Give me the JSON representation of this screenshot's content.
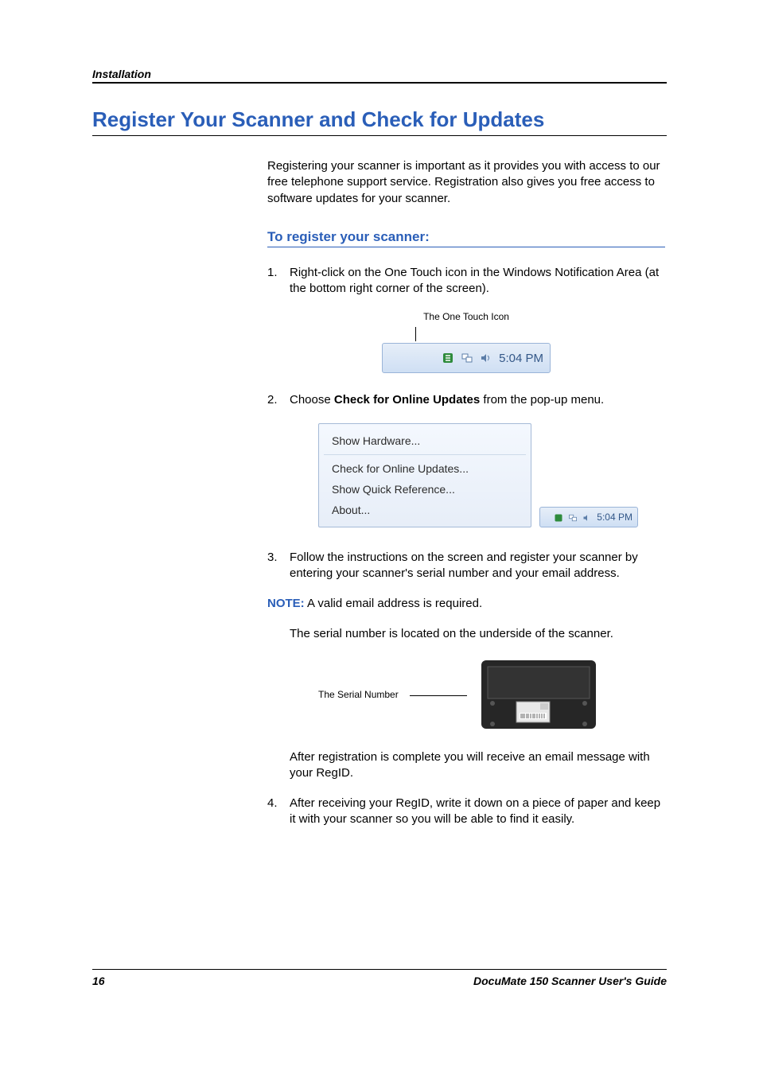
{
  "header": {
    "running": "Installation"
  },
  "h1": "Register Your Scanner and Check for Updates",
  "intro": "Registering your scanner is important as it provides you with access to our free telephone support service. Registration also gives you free access to software updates for your scanner.",
  "h2": "To register your scanner:",
  "steps": {
    "s1_num": "1.",
    "s1": "Right-click on the One Touch icon in the Windows Notification Area (at the bottom right corner of the screen).",
    "s2_num": "2.",
    "s2_prefix": "Choose ",
    "s2_bold": "Check for Online Updates",
    "s2_suffix": " from the pop-up menu.",
    "s3_num": "3.",
    "s3": "Follow the instructions on the screen and register your scanner by entering your scanner's serial number and your email address.",
    "s4_num": "4.",
    "s4": "After receiving your RegID, write it down on a piece of paper and keep it with your scanner so you will be able to find it easily."
  },
  "tray_caption": "The One Touch Icon",
  "tray_time": "5:04 PM",
  "popup": {
    "mi1": "Show Hardware...",
    "mi2": "Check for Online Updates...",
    "mi3": "Show Quick Reference...",
    "mi4": "About..."
  },
  "note_label": "NOTE:",
  "note_text": "  A valid email address is required.",
  "serial_p": "The serial number is located on the underside of the scanner.",
  "serial_label": "The Serial Number",
  "post_reg": "After registration is complete you will receive an email message with your RegID.",
  "footer": {
    "page": "16",
    "title": "DocuMate 150 Scanner User's Guide"
  },
  "icons": {
    "onetouch": "onetouch-icon",
    "net": "network-icon",
    "vol": "volume-icon"
  }
}
